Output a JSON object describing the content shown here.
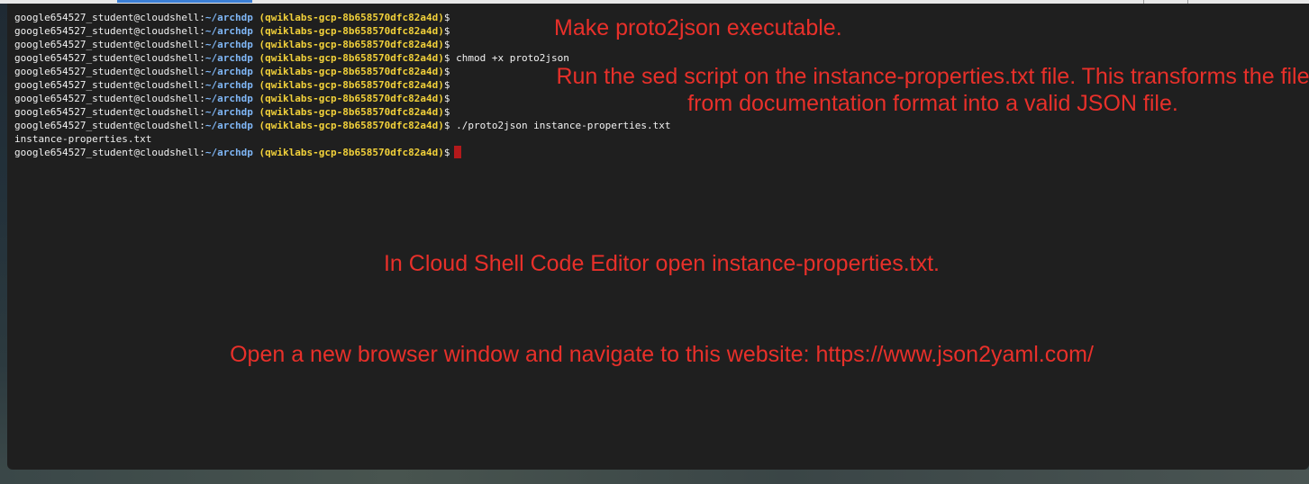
{
  "prompt": {
    "user_host": "google654527_student@cloudshell:",
    "path": "~/archdp",
    "project": "(qwiklabs-gcp-8b658570dfc82a4d)",
    "dollar": "$"
  },
  "lines": [
    {
      "type": "prompt",
      "command": ""
    },
    {
      "type": "prompt",
      "command": ""
    },
    {
      "type": "prompt",
      "command": ""
    },
    {
      "type": "prompt",
      "command": "chmod +x proto2json"
    },
    {
      "type": "prompt",
      "command": ""
    },
    {
      "type": "prompt",
      "command": ""
    },
    {
      "type": "prompt",
      "command": ""
    },
    {
      "type": "prompt",
      "command": ""
    },
    {
      "type": "prompt",
      "command": "./proto2json instance-properties.txt"
    },
    {
      "type": "output",
      "text": "instance-properties.txt"
    },
    {
      "type": "prompt",
      "command": "",
      "cursor": true
    }
  ],
  "annotations": {
    "make_executable": "Make proto2json executable.",
    "run_sed": "Run the sed script on the instance-properties.txt file. This transforms the file from documentation format into a valid JSON file.",
    "open_editor": "In Cloud Shell Code Editor open instance-properties.txt.",
    "open_browser": "Open a new browser window and navigate to this website: https://www.json2yaml.com/"
  },
  "colors": {
    "annotation": "#e8302a",
    "path": "#7fb6f5",
    "project": "#f2d13a",
    "cursor": "#b3191b",
    "terminal_bg": "#1f1f1f"
  }
}
